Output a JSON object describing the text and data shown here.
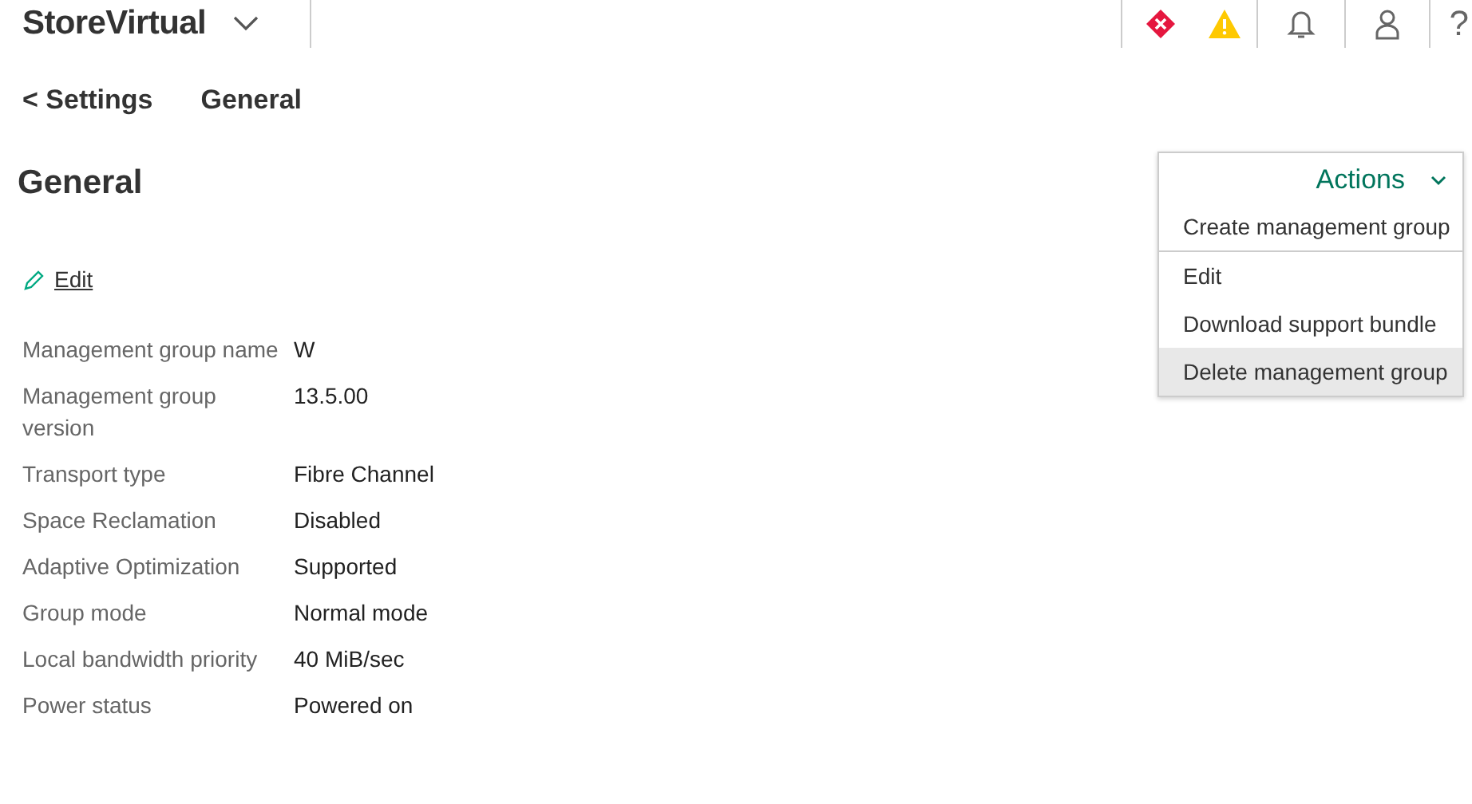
{
  "header": {
    "product": "StoreVirtual",
    "help": "?"
  },
  "breadcrumb": {
    "back": "< Settings",
    "current": "General"
  },
  "title": "General",
  "edit_link": "Edit",
  "properties": [
    {
      "label": "Management group name",
      "value": "W"
    },
    {
      "label": "Management group version",
      "value": "13.5.00"
    },
    {
      "label": "Transport type",
      "value": "Fibre Channel"
    },
    {
      "label": "Space Reclamation",
      "value": "Disabled"
    },
    {
      "label": "Adaptive Optimization",
      "value": "Supported"
    },
    {
      "label": "Group mode",
      "value": "Normal mode"
    },
    {
      "label": "Local bandwidth priority",
      "value": "40 MiB/sec"
    },
    {
      "label": "Power status",
      "value": "Powered on"
    }
  ],
  "actions_menu": {
    "label": "Actions",
    "groups": [
      [
        {
          "label": "Create management group",
          "selected": false
        }
      ],
      [
        {
          "label": "Edit",
          "selected": false
        },
        {
          "label": "Download support bundle",
          "selected": false
        },
        {
          "label": "Delete management group",
          "selected": true
        }
      ]
    ]
  }
}
